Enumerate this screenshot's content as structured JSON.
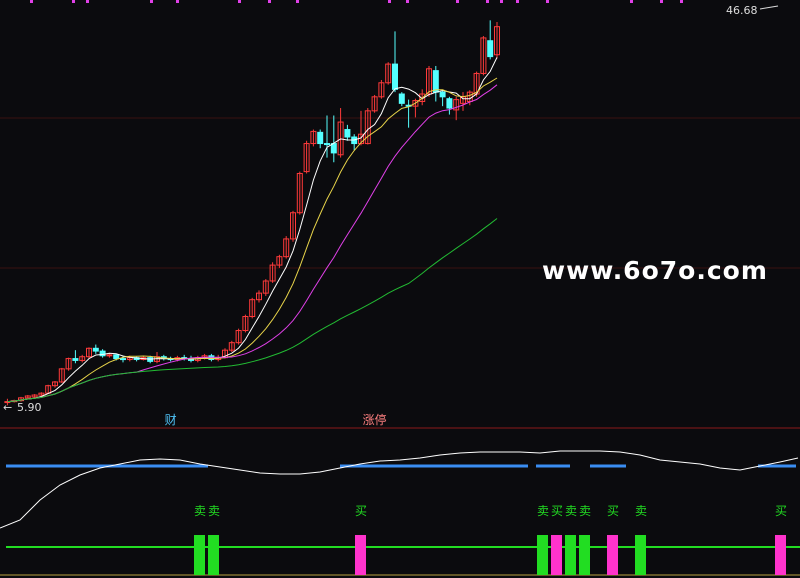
{
  "chart_data": {
    "type": "candlestick",
    "main_panel": {
      "price_high_label": "46.68",
      "price_low_label": "5.90",
      "ylim": [
        5.0,
        48.0
      ],
      "candles": [
        [
          5.8,
          5.9,
          5.5,
          6.2
        ],
        [
          5.9,
          6.0,
          5.8,
          6.1
        ],
        [
          6.0,
          6.3,
          5.9,
          6.4
        ],
        [
          6.3,
          6.5,
          6.2,
          6.6
        ],
        [
          6.4,
          6.6,
          6.3,
          6.7
        ],
        [
          6.6,
          6.8,
          6.5,
          6.9
        ],
        [
          6.8,
          7.6,
          6.7,
          7.7
        ],
        [
          7.6,
          8.0,
          7.4,
          8.1
        ],
        [
          8.0,
          9.4,
          7.9,
          9.5
        ],
        [
          9.4,
          10.5,
          9.2,
          10.6
        ],
        [
          10.5,
          10.3,
          10.0,
          11.4
        ],
        [
          10.3,
          10.7,
          10.1,
          10.9
        ],
        [
          10.7,
          11.6,
          10.5,
          11.7
        ],
        [
          11.6,
          11.3,
          11.0,
          12.0
        ],
        [
          11.3,
          10.8,
          10.6,
          11.5
        ],
        [
          10.8,
          10.9,
          10.6,
          11.1
        ],
        [
          10.9,
          10.5,
          10.3,
          11.0
        ],
        [
          10.5,
          10.4,
          10.1,
          10.8
        ],
        [
          10.4,
          10.6,
          10.2,
          10.8
        ],
        [
          10.6,
          10.4,
          10.2,
          10.7
        ],
        [
          10.4,
          10.6,
          10.3,
          10.8
        ],
        [
          10.6,
          10.2,
          10.0,
          10.8
        ],
        [
          10.2,
          10.7,
          10.0,
          11.2
        ],
        [
          10.7,
          10.5,
          10.3,
          10.9
        ],
        [
          10.5,
          10.4,
          10.2,
          10.7
        ],
        [
          10.4,
          10.6,
          10.2,
          10.8
        ],
        [
          10.6,
          10.5,
          10.3,
          10.9
        ],
        [
          10.5,
          10.3,
          10.1,
          10.8
        ],
        [
          10.3,
          10.6,
          10.1,
          10.8
        ],
        [
          10.6,
          10.8,
          10.4,
          11.0
        ],
        [
          10.8,
          10.4,
          10.2,
          11.0
        ],
        [
          10.4,
          10.6,
          10.2,
          10.9
        ],
        [
          10.6,
          11.4,
          10.5,
          11.6
        ],
        [
          11.4,
          12.2,
          11.2,
          12.4
        ],
        [
          12.2,
          13.5,
          12.0,
          13.7
        ],
        [
          13.5,
          15.0,
          13.3,
          15.2
        ],
        [
          15.0,
          16.8,
          14.8,
          17.0
        ],
        [
          16.8,
          17.5,
          16.5,
          17.8
        ],
        [
          17.5,
          18.8,
          17.2,
          19.0
        ],
        [
          18.8,
          20.5,
          18.6,
          20.8
        ],
        [
          20.5,
          21.4,
          20.2,
          21.6
        ],
        [
          21.4,
          23.3,
          21.2,
          23.6
        ],
        [
          23.3,
          26.1,
          23.0,
          26.3
        ],
        [
          26.1,
          30.3,
          25.9,
          30.5
        ],
        [
          30.5,
          33.5,
          30.3,
          33.8
        ],
        [
          33.5,
          34.8,
          33.2,
          35.0
        ],
        [
          34.7,
          33.5,
          33.0,
          35.0
        ],
        [
          33.5,
          33.4,
          32.0,
          36.5
        ],
        [
          33.5,
          32.5,
          31.5,
          36.5
        ],
        [
          32.3,
          35.8,
          32.0,
          37.3
        ],
        [
          35.0,
          34.2,
          33.8,
          35.5
        ],
        [
          34.2,
          33.5,
          32.8,
          34.5
        ],
        [
          33.5,
          34.5,
          33.3,
          37.0
        ],
        [
          33.5,
          37.0,
          33.4,
          37.3
        ],
        [
          37.0,
          38.5,
          36.8,
          38.7
        ],
        [
          38.5,
          40.0,
          38.3,
          40.3
        ],
        [
          40.0,
          42.0,
          39.8,
          42.2
        ],
        [
          42.0,
          39.3,
          39.0,
          45.5
        ],
        [
          38.8,
          37.8,
          37.5,
          39.0
        ],
        [
          37.6,
          37.5,
          35.2,
          38.2
        ],
        [
          37.5,
          38.1,
          36.3,
          38.3
        ],
        [
          38.0,
          38.8,
          37.6,
          39.3
        ],
        [
          38.8,
          41.5,
          38.5,
          41.8
        ],
        [
          41.3,
          39.0,
          38.0,
          41.8
        ],
        [
          39.0,
          38.5,
          37.5,
          39.2
        ],
        [
          38.3,
          37.3,
          36.6,
          38.5
        ],
        [
          37.1,
          38.2,
          36.0,
          38.5
        ],
        [
          37.8,
          38.5,
          37.0,
          39.0
        ],
        [
          38.0,
          39.0,
          37.6,
          39.2
        ],
        [
          38.8,
          41.0,
          38.5,
          41.2
        ],
        [
          41.0,
          44.8,
          40.8,
          45.0
        ],
        [
          44.5,
          42.8,
          42.5,
          46.68
        ],
        [
          43.0,
          46.0,
          42.6,
          46.5
        ]
      ],
      "moving_averages": [
        {
          "color": "#ffffff",
          "period": 5
        },
        {
          "color": "#e8d44a",
          "period": 10
        },
        {
          "color": "#e040e8",
          "period": 20
        },
        {
          "color": "#22bb33",
          "period": 60
        }
      ],
      "markers": [
        {
          "index": 24,
          "text": "财",
          "color": "#4fc3f7"
        },
        {
          "index": 54,
          "text": "涨停",
          "color": "#ff8080"
        }
      ],
      "watermark": "www.6o7o.com"
    },
    "indicator_panel": {
      "signals": [
        {
          "index": 28,
          "text": "卖",
          "color": "#22dd22"
        },
        {
          "index": 30,
          "text": "卖",
          "color": "#22dd22"
        },
        {
          "index": 51,
          "text": "买",
          "color": "#ff33cc"
        },
        {
          "index": 77,
          "text": "卖",
          "color": "#22dd22"
        },
        {
          "index": 79,
          "text": "买",
          "color": "#ff33cc"
        },
        {
          "index": 81,
          "text": "卖",
          "color": "#22dd22"
        },
        {
          "index": 83,
          "text": "卖",
          "color": "#22dd22"
        },
        {
          "index": 87,
          "text": "买",
          "color": "#ff33cc"
        },
        {
          "index": 91,
          "text": "卖",
          "color": "#22dd22"
        },
        {
          "index": 111,
          "text": "买",
          "color": "#ff33cc"
        }
      ]
    }
  }
}
